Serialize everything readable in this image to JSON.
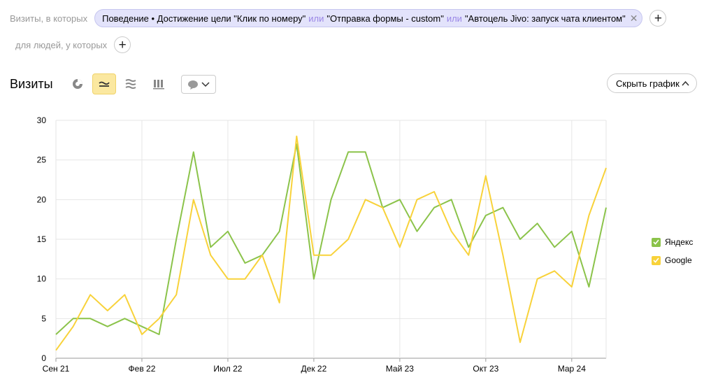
{
  "filters": {
    "visits_label": "Визиты, в которых",
    "segment": {
      "part1": "Поведение • Достижение цели \"Клик по номеру\"",
      "or1": "или",
      "part2": "\"Отправка формы - custom\"",
      "or2": "или",
      "part3": "\"Автоцель Jivo: запуск чата клиентом\""
    },
    "people_label": "для людей, у которых"
  },
  "toolbar": {
    "title": "Визиты",
    "hide_chart_label": "Скрыть график"
  },
  "colors": {
    "yandex": "#8bc34a",
    "google": "#f8d23a",
    "grid": "#e6e6e6"
  },
  "chart_data": {
    "type": "line",
    "title": "",
    "xlabel": "",
    "ylabel": "",
    "ylim": [
      0,
      30
    ],
    "yticks": [
      0,
      5,
      10,
      15,
      20,
      25,
      30
    ],
    "x_count": 32,
    "x_tick_labels": [
      {
        "label": "Сен 21",
        "index": 0
      },
      {
        "label": "Фев 22",
        "index": 5
      },
      {
        "label": "Июл 22",
        "index": 10
      },
      {
        "label": "Дек 22",
        "index": 15
      },
      {
        "label": "Май 23",
        "index": 20
      },
      {
        "label": "Окт 23",
        "index": 25
      },
      {
        "label": "Мар 24",
        "index": 30
      }
    ],
    "legend_position": "right",
    "series": [
      {
        "name": "Яндекс",
        "color": "#8bc34a",
        "values": [
          3,
          5,
          5,
          4,
          5,
          4,
          3,
          15,
          26,
          14,
          16,
          12,
          13,
          16,
          27,
          10,
          20,
          26,
          26,
          19,
          20,
          16,
          19,
          20,
          14,
          18,
          19,
          15,
          17,
          14,
          16,
          9,
          19
        ]
      },
      {
        "name": "Google",
        "color": "#f8d23a",
        "values": [
          1,
          4,
          8,
          6,
          8,
          3,
          5,
          8,
          20,
          13,
          10,
          10,
          13,
          7,
          28,
          13,
          13,
          15,
          20,
          19,
          14,
          20,
          21,
          16,
          13,
          23,
          13,
          2,
          10,
          11,
          9,
          18,
          24
        ]
      }
    ]
  }
}
